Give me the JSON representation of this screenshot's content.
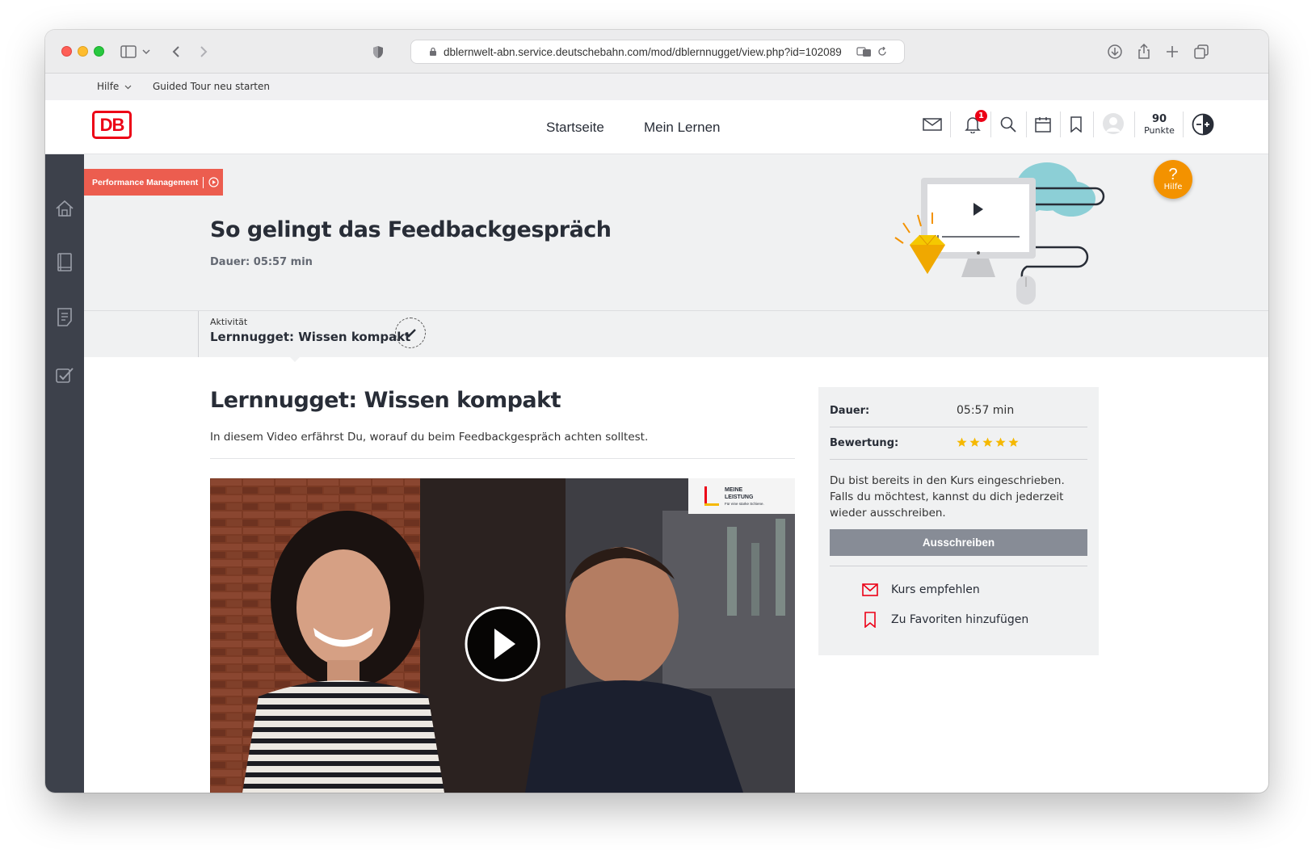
{
  "browser": {
    "url": "dblernwelt-abn.service.deutschebahn.com/mod/dblernnugget/view.php?id=102089"
  },
  "topbar": {
    "help_label": "Hilfe",
    "guided_tour": "Guided Tour neu starten"
  },
  "header": {
    "logo_text": "DB",
    "nav": [
      "Startseite",
      "Mein Lernen"
    ],
    "notification_count": "1",
    "points_value": "90",
    "points_label": "Punkte"
  },
  "hero": {
    "category_tag": "Performance Management",
    "title": "So gelingt das Feedbackgespräch",
    "duration": "Dauer: 05:57 min",
    "help_badge_label": "Hilfe"
  },
  "activity": {
    "label": "Aktivität",
    "title": "Lernnugget: Wissen kompakt"
  },
  "content": {
    "title": "Lernnugget: Wissen kompakt",
    "description": "In diesem Video erfährst Du, worauf du beim Feedbackgespräch achten solltest.",
    "video_logo_line1": "MEINE",
    "video_logo_line2": "LEISTUNG",
    "video_logo_line3": "Für eine starke Schiene."
  },
  "panel": {
    "duration_label": "Dauer:",
    "duration_value": "05:57 min",
    "rating_label": "Bewertung:",
    "rating_stars": 5,
    "enrolled_text": "Du bist bereits in den Kurs eingeschrieben. Falls du möchtest, kannst du dich jederzeit wieder ausschreiben.",
    "unsubscribe_button": "Ausschreiben",
    "recommend_link": "Kurs empfehlen",
    "favorites_link": "Zu Favoriten hinzufügen"
  },
  "colors": {
    "db_red": "#ec0016",
    "rail": "#3d414b",
    "help_orange": "#f39200",
    "star": "#f5b800"
  }
}
